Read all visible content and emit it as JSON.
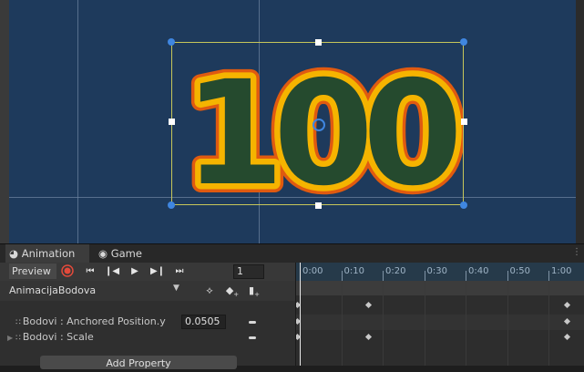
{
  "tabs": {
    "animation": "Animation",
    "game": "Game"
  },
  "toolbar": {
    "preview_label": "Preview",
    "frame_value": "1"
  },
  "clip": {
    "name": "AnimacijaBodova"
  },
  "score": {
    "text": "100"
  },
  "properties": [
    {
      "label": "Bodovi : Anchored Position.y",
      "value": "0.0505"
    },
    {
      "label": "Bodovi : Scale"
    }
  ],
  "add_property_label": "Add Property",
  "ruler": {
    "ticks": [
      "0:00",
      "0:10",
      "0:20",
      "0:30",
      "0:40",
      "0:50",
      "1:00"
    ]
  },
  "icons": [
    "record-icon",
    "first-key-icon",
    "prev-key-icon",
    "play-icon",
    "next-key-icon",
    "last-key-icon",
    "add-keyframe-icon",
    "add-event-icon",
    "filter-icon"
  ],
  "colors": {
    "scene_bg": "#1e3a5c",
    "number_fill": "#254a2e",
    "number_stroke": "#f5b400",
    "number_outline": "#e05a10",
    "handle_blue": "#3f86e0",
    "record_red": "#e24a3b"
  }
}
